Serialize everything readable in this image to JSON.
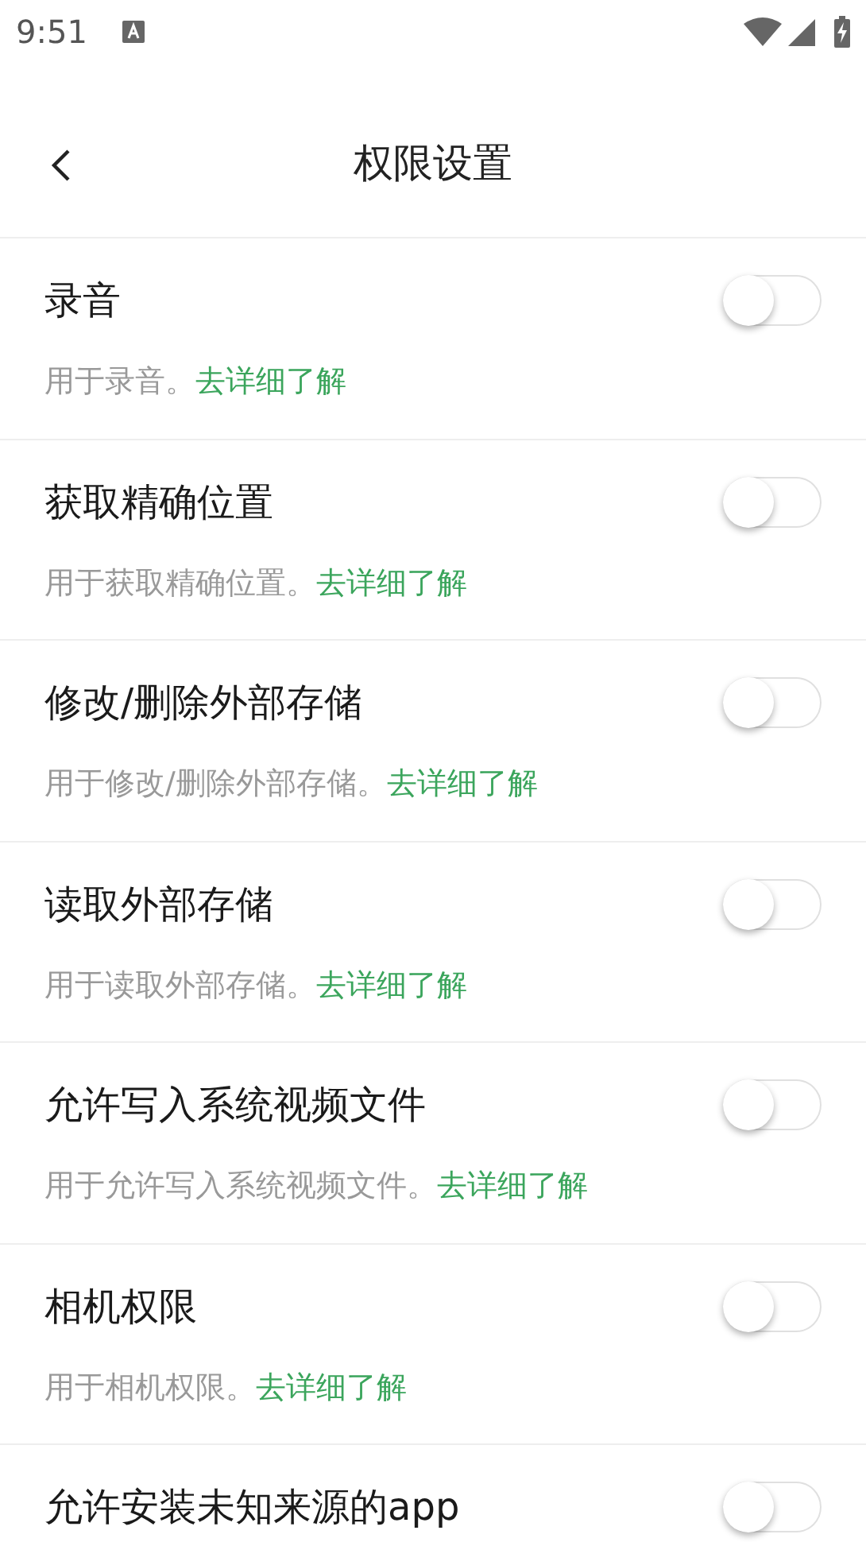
{
  "status_bar": {
    "time": "9:51"
  },
  "header": {
    "title": "权限设置"
  },
  "permissions": [
    {
      "title": "录音",
      "description": "用于录音。",
      "link": "去详细了解",
      "on": false
    },
    {
      "title": "获取精确位置",
      "description": "用于获取精确位置。",
      "link": "去详细了解",
      "on": false
    },
    {
      "title": "修改/删除外部存储",
      "description": "用于修改/删除外部存储。",
      "link": "去详细了解",
      "on": false
    },
    {
      "title": "读取外部存储",
      "description": "用于读取外部存储。",
      "link": "去详细了解",
      "on": false
    },
    {
      "title": "允许写入系统视频文件",
      "description": "用于允许写入系统视频文件。",
      "link": "去详细了解",
      "on": false
    },
    {
      "title": "相机权限",
      "description": "用于相机权限。",
      "link": "去详细了解",
      "on": false
    },
    {
      "title": "允许安装未知来源的app",
      "on": false
    }
  ]
}
